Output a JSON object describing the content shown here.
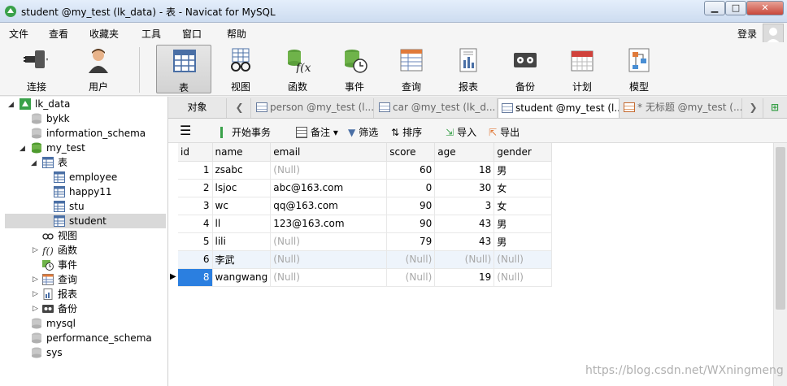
{
  "window": {
    "title": "student @my_test (lk_data) - 表 - Navicat for MySQL"
  },
  "menu": {
    "items": [
      "文件",
      "查看",
      "收藏夹",
      "工具",
      "窗口",
      "帮助"
    ],
    "login": "登录"
  },
  "toolbar": {
    "items": [
      {
        "label": "连接",
        "icon": "plug-icon"
      },
      {
        "label": "用户",
        "icon": "user-icon"
      },
      {
        "label": "表",
        "icon": "table-icon"
      },
      {
        "label": "视图",
        "icon": "view-glasses-icon"
      },
      {
        "label": "函数",
        "icon": "function-icon"
      },
      {
        "label": "事件",
        "icon": "event-clock-icon"
      },
      {
        "label": "查询",
        "icon": "query-icon"
      },
      {
        "label": "报表",
        "icon": "report-icon"
      },
      {
        "label": "备份",
        "icon": "backup-tape-icon"
      },
      {
        "label": "计划",
        "icon": "calendar-icon"
      },
      {
        "label": "模型",
        "icon": "model-icon"
      }
    ]
  },
  "sidebar": {
    "connection": "lk_data",
    "databases": {
      "bykk": "bykk",
      "information_schema": "information_schema",
      "my_test": "my_test",
      "mysql": "mysql",
      "performance_schema": "performance_schema",
      "sys": "sys"
    },
    "groups": {
      "tables": "表",
      "views": "视图",
      "functions": "函数",
      "events": "事件",
      "queries": "查询",
      "reports": "报表",
      "backups": "备份"
    },
    "tables": [
      "employee",
      "happy11",
      "stu",
      "student"
    ]
  },
  "tabs": {
    "objects": "对象",
    "items": [
      "person @my_test (l...",
      "car @my_test (lk_d...",
      "student @my_test (l...",
      "* 无标题 @my_test (..."
    ]
  },
  "subtoolbar": {
    "begin_tx": "开始事务",
    "note": "备注",
    "filter": "筛选",
    "sort": "排序",
    "import": "导入",
    "export": "导出"
  },
  "table": {
    "columns": [
      "id",
      "name",
      "email",
      "score",
      "age",
      "gender"
    ],
    "null_text": "(Null)",
    "rows": [
      {
        "id": "1",
        "name": "zsabc",
        "email": "(Null)",
        "score": "60",
        "age": "18",
        "gender": "男"
      },
      {
        "id": "2",
        "name": "lsjoc",
        "email": "abc@163.com",
        "score": "0",
        "age": "30",
        "gender": "女"
      },
      {
        "id": "3",
        "name": "wc",
        "email": "qq@163.com",
        "score": "90",
        "age": "3",
        "gender": "女"
      },
      {
        "id": "4",
        "name": "ll",
        "email": "123@163.com",
        "score": "90",
        "age": "43",
        "gender": "男"
      },
      {
        "id": "5",
        "name": "lili",
        "email": "(Null)",
        "score": "79",
        "age": "43",
        "gender": "男"
      },
      {
        "id": "6",
        "name": "李武",
        "email": "(Null)",
        "score": "(Null)",
        "age": "(Null)",
        "gender": "(Null)"
      },
      {
        "id": "8",
        "name": "wangwang",
        "email": "(Null)",
        "score": "(Null)",
        "age": "19",
        "gender": "(Null)"
      }
    ]
  },
  "watermark": "https://blog.csdn.net/WXningmeng"
}
